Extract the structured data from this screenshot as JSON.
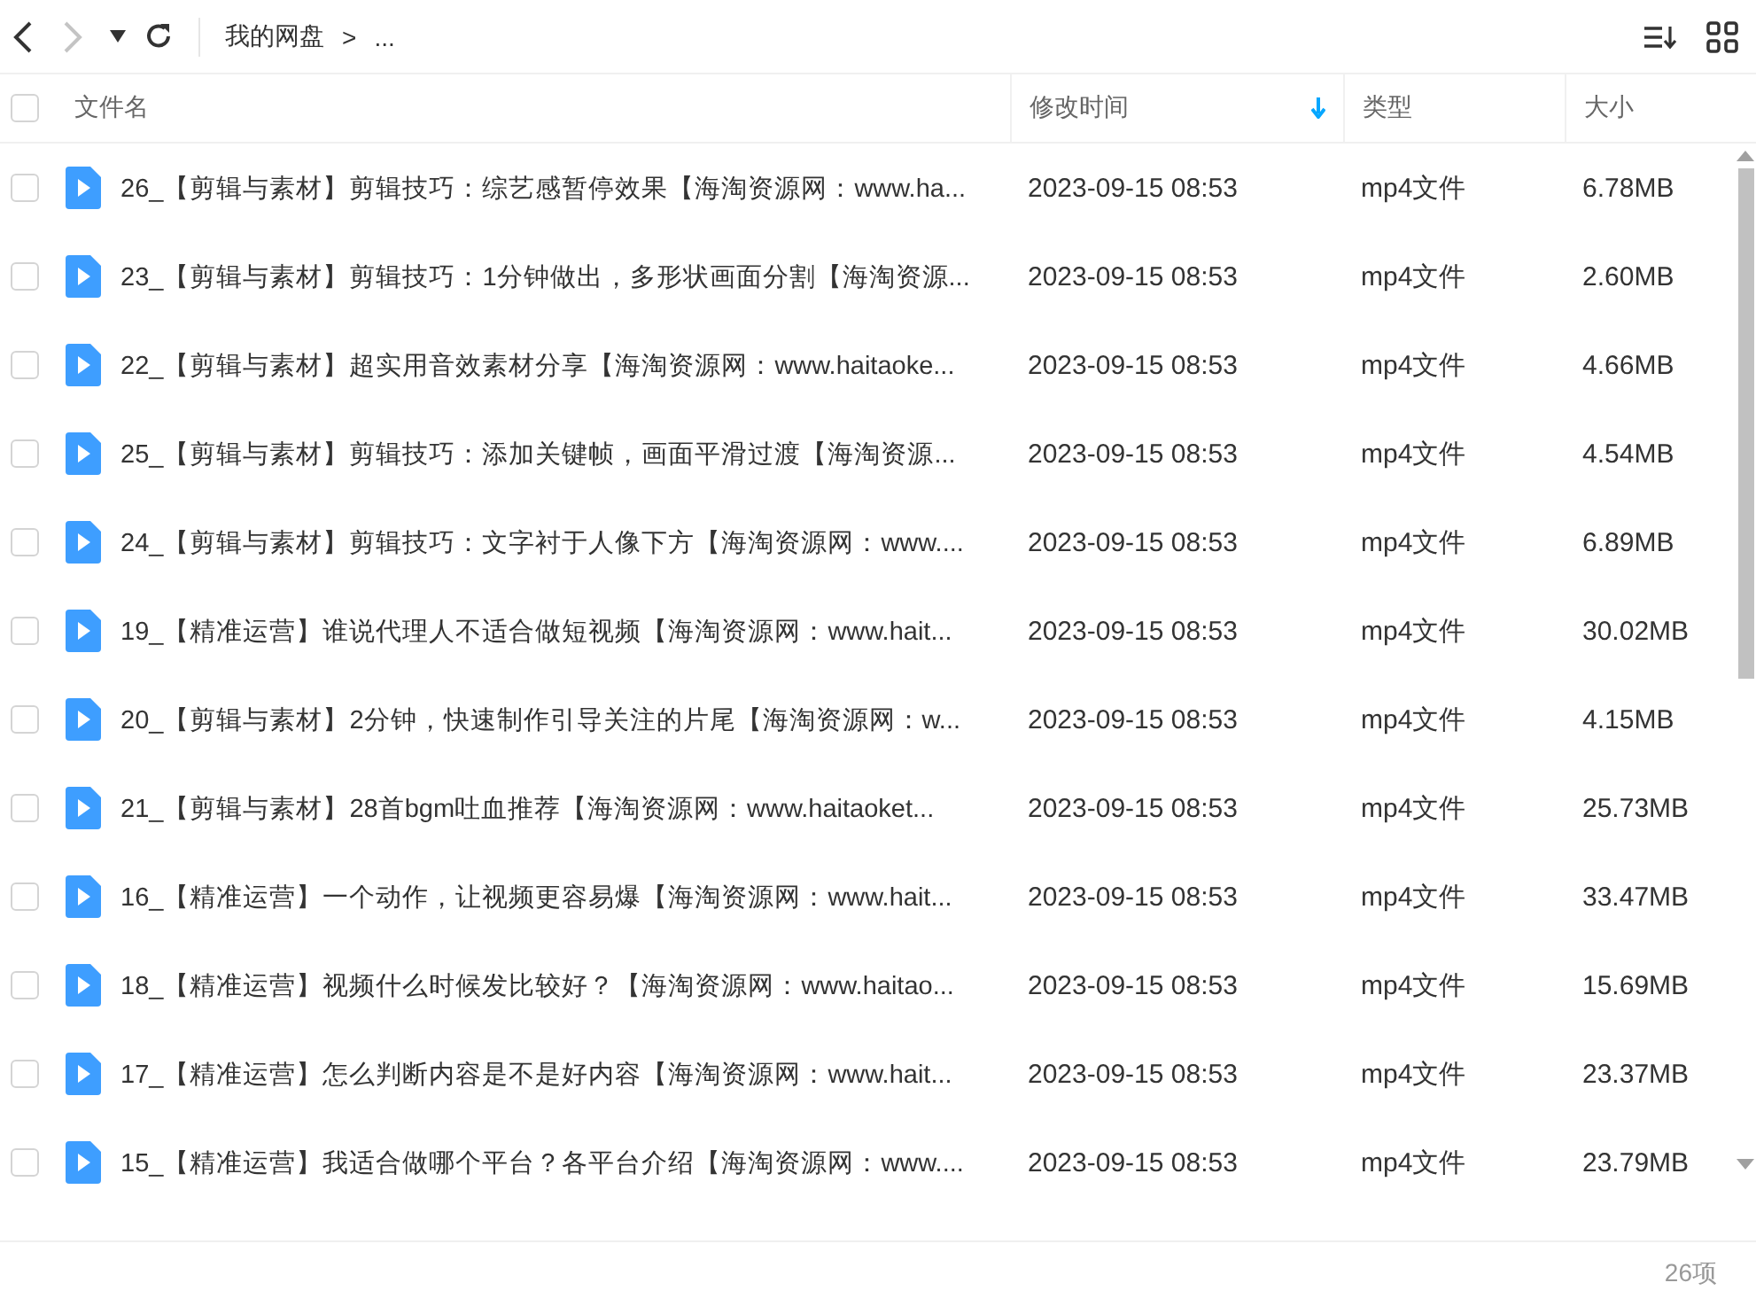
{
  "toolbar": {
    "back": {
      "disabled": false
    },
    "forward": {
      "disabled": true
    },
    "breadcrumb": [
      "我的网盘",
      "..."
    ],
    "breadcrumb_separator": ">"
  },
  "table": {
    "select_all": {
      "checked": false
    },
    "columns": [
      {
        "label": "文件名",
        "sorted": false
      },
      {
        "label": "修改时间",
        "sorted": true
      },
      {
        "label": "类型",
        "sorted": false
      },
      {
        "label": "大小",
        "sorted": false
      }
    ],
    "rows": [
      {
        "name": "26_【剪辑与素材】剪辑技巧：综艺感暂停效果【海淘资源网：www.ha...",
        "modified": "2023-09-15 08:53",
        "type": "mp4文件",
        "size": "6.78MB",
        "checked": false
      },
      {
        "name": "23_【剪辑与素材】剪辑技巧：1分钟做出，多形状画面分割【海淘资源...",
        "modified": "2023-09-15 08:53",
        "type": "mp4文件",
        "size": "2.60MB",
        "checked": false
      },
      {
        "name": "22_【剪辑与素材】超实用音效素材分享【海淘资源网：www.haitaoke...",
        "modified": "2023-09-15 08:53",
        "type": "mp4文件",
        "size": "4.66MB",
        "checked": false
      },
      {
        "name": "25_【剪辑与素材】剪辑技巧：添加关键帧，画面平滑过渡【海淘资源...",
        "modified": "2023-09-15 08:53",
        "type": "mp4文件",
        "size": "4.54MB",
        "checked": false
      },
      {
        "name": "24_【剪辑与素材】剪辑技巧：文字衬于人像下方【海淘资源网：www....",
        "modified": "2023-09-15 08:53",
        "type": "mp4文件",
        "size": "6.89MB",
        "checked": false
      },
      {
        "name": "19_【精准运营】谁说代理人不适合做短视频【海淘资源网：www.hait...",
        "modified": "2023-09-15 08:53",
        "type": "mp4文件",
        "size": "30.02MB",
        "checked": false
      },
      {
        "name": "20_【剪辑与素材】2分钟，快速制作引导关注的片尾【海淘资源网：w...",
        "modified": "2023-09-15 08:53",
        "type": "mp4文件",
        "size": "4.15MB",
        "checked": false
      },
      {
        "name": "21_【剪辑与素材】28首bgm吐血推荐【海淘资源网：www.haitaoket...",
        "modified": "2023-09-15 08:53",
        "type": "mp4文件",
        "size": "25.73MB",
        "checked": false
      },
      {
        "name": "16_【精准运营】一个动作，让视频更容易爆【海淘资源网：www.hait...",
        "modified": "2023-09-15 08:53",
        "type": "mp4文件",
        "size": "33.47MB",
        "checked": false
      },
      {
        "name": "18_【精准运营】视频什么时候发比较好？【海淘资源网：www.haitao...",
        "modified": "2023-09-15 08:53",
        "type": "mp4文件",
        "size": "15.69MB",
        "checked": false
      },
      {
        "name": "17_【精准运营】怎么判断内容是不是好内容【海淘资源网：www.hait...",
        "modified": "2023-09-15 08:53",
        "type": "mp4文件",
        "size": "23.37MB",
        "checked": false
      },
      {
        "name": "15_【精准运营】我适合做哪个平台？各平台介绍【海淘资源网：www....",
        "modified": "2023-09-15 08:53",
        "type": "mp4文件",
        "size": "23.79MB",
        "checked": false
      }
    ]
  },
  "status_bar": {
    "count": "26项"
  }
}
